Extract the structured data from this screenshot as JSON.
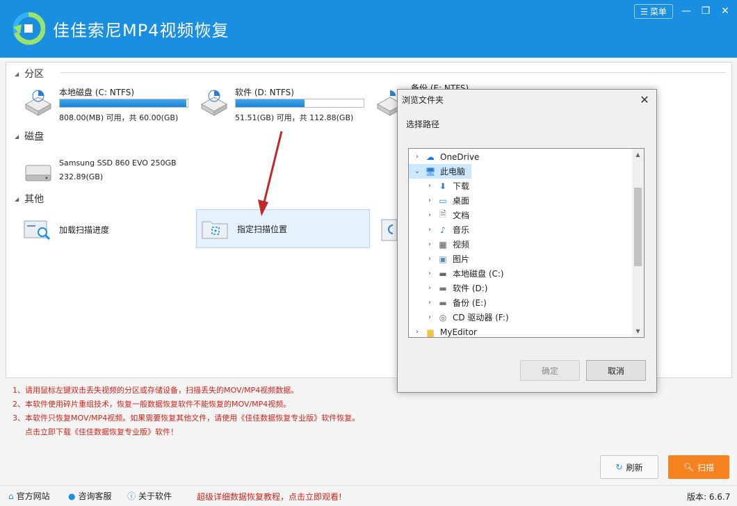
{
  "app": {
    "title": "佳佳索尼MP4视频恢复",
    "menu_label": "菜单"
  },
  "sections": {
    "partition": "分区",
    "disk": "磁盘",
    "other": "其他"
  },
  "partitions": [
    {
      "name": "本地磁盘 (C: NTFS)",
      "info": "808.00(MB) 可用，共 60.00(GB)",
      "used_fraction": 0.987
    },
    {
      "name": "软件 (D: NTFS)",
      "info": "51.51(GB) 可用，共 112.88(GB)",
      "used_fraction": 0.54
    },
    {
      "name": "备份 (E: NTFS)"
    }
  ],
  "disks": [
    {
      "name": "Samsung SSD 860 EVO 250GB",
      "size": "232.89(GB)"
    }
  ],
  "others": [
    {
      "label": "加载扫描进度"
    },
    {
      "label": "指定扫描位置"
    }
  ],
  "notes": [
    "1、请用鼠标左键双击丢失视频的分区或存储设备，扫描丢失的MOV/MP4视频数据。",
    "2、本软件使用碎片重组技术，恢复一般数据恢复软件不能恢复的MOV/MP4视频。",
    "3、本软件只恢复MOV/MP4视频。如果需要恢复其他文件，请使用《佳佳数据恢复专业版》软件恢复。",
    "点击立即下载《佳佳数据恢复专业版》软件！"
  ],
  "buttons": {
    "refresh": "刷新",
    "scan": "扫描"
  },
  "footer": {
    "website": "官方网站",
    "support": "咨询客服",
    "about": "关于软件",
    "promo": "超级详细数据恢复教程，点击立即观看!",
    "version": "版本: 6.6.7"
  },
  "dialog": {
    "title": "浏览文件夹",
    "prompt": "选择路径",
    "ok": "确定",
    "cancel": "取消",
    "tree": [
      {
        "label": "OneDrive",
        "icon": "cloud-icon",
        "level": 0,
        "expanded": false
      },
      {
        "label": "此电脑",
        "icon": "computer-icon",
        "level": 0,
        "expanded": true,
        "selected": true
      },
      {
        "label": "下载",
        "icon": "download-icon",
        "level": 1
      },
      {
        "label": "桌面",
        "icon": "desktop-icon",
        "level": 1
      },
      {
        "label": "文档",
        "icon": "document-icon",
        "level": 1
      },
      {
        "label": "音乐",
        "icon": "music-icon",
        "level": 1
      },
      {
        "label": "视频",
        "icon": "video-icon",
        "level": 1
      },
      {
        "label": "图片",
        "icon": "picture-icon",
        "level": 1
      },
      {
        "label": "本地磁盘 (C:)",
        "icon": "system-drive-icon",
        "level": 1
      },
      {
        "label": "软件 (D:)",
        "icon": "drive-icon",
        "level": 1
      },
      {
        "label": "备份 (E:)",
        "icon": "drive-icon",
        "level": 1
      },
      {
        "label": "CD 驱动器 (F:)",
        "icon": "cd-drive-icon",
        "level": 1
      },
      {
        "label": "MyEditor",
        "icon": "folder-icon",
        "level": 0,
        "expanded": false
      }
    ]
  },
  "colors": {
    "titlebar": "#1a8ee1",
    "scan_button": "#f5821f",
    "note_text": "#d2261c",
    "arrow": "#c0282a"
  }
}
